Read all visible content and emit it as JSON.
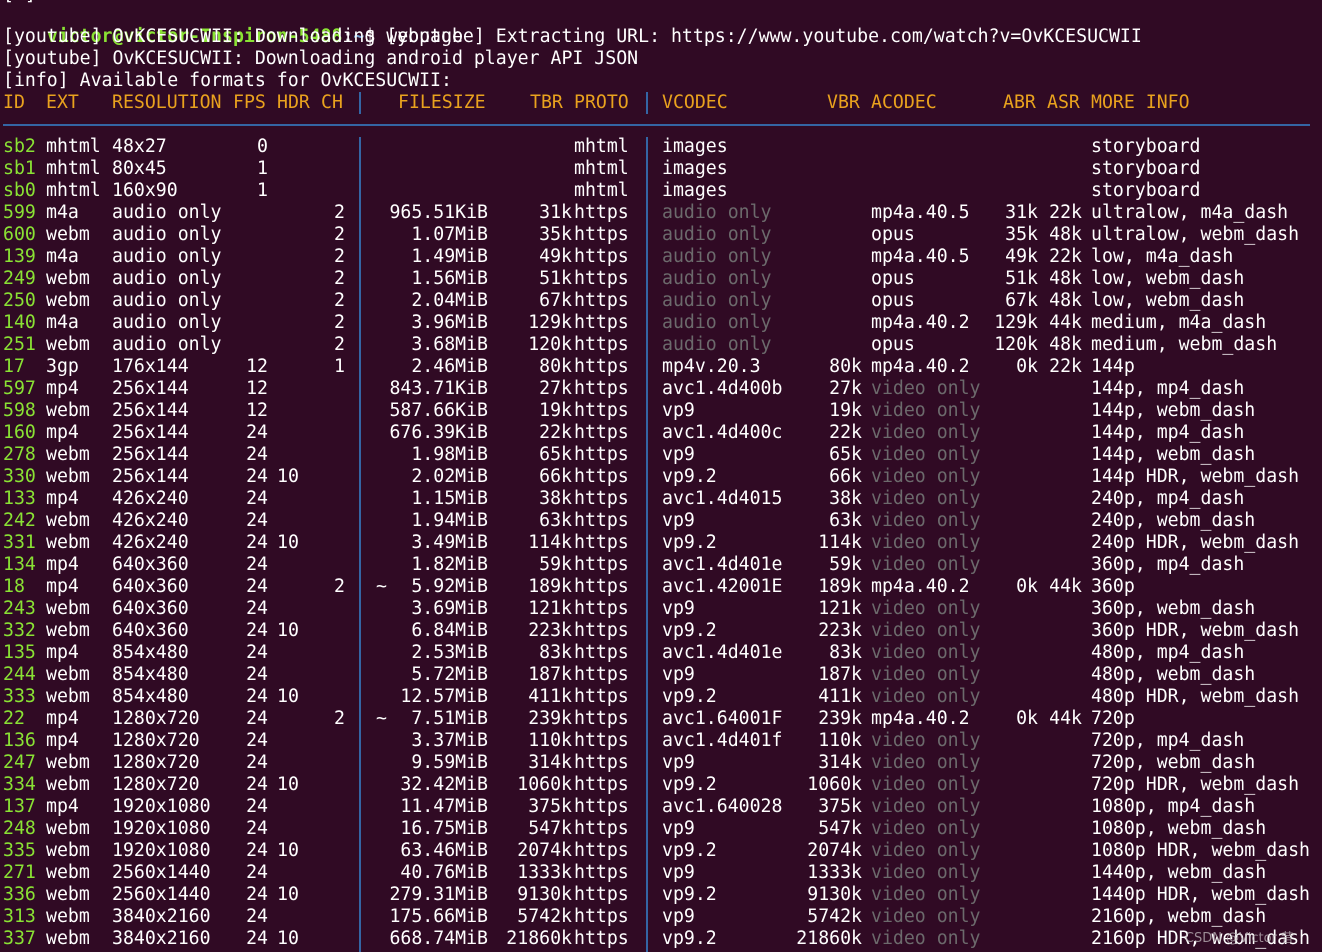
{
  "top_fragment": "[ ]",
  "prompt": {
    "user_host": "victor@victor-Inspiron-5488",
    "path": ":~",
    "symbol": "$",
    "command": " [youtube] Extracting URL: https://www.youtube.com/watch?v=OvKCESUCWII"
  },
  "log_lines": [
    "[youtube] OvKCESUCWII: Downloading webpage",
    "[youtube] OvKCESUCWII: Downloading android player API JSON",
    "[info] Available formats for OvKCESUCWII:"
  ],
  "headers": {
    "id": "ID",
    "ext": "EXT",
    "res": "RESOLUTION",
    "fps": "FPS",
    "hdr": "HDR",
    "ch": "CH",
    "filesize": "FILESIZE",
    "tbr": "TBR",
    "proto": "PROTO",
    "vcodec": "VCODEC",
    "vbr": "VBR",
    "acodec": "ACODEC",
    "abr": "ABR",
    "asr": "ASR",
    "info": "MORE INFO"
  },
  "formats": [
    {
      "id": "sb2",
      "ext": "mhtml",
      "res": "48x27",
      "fps": "0",
      "hdr": "",
      "ch": "",
      "approx": "",
      "size": "",
      "tbr": "",
      "proto": "mhtml",
      "vcodec": "images",
      "vcodec_dim": false,
      "vbr": "",
      "acodec": "",
      "acodec_dim": false,
      "abr": "",
      "asr": "",
      "info": "storyboard"
    },
    {
      "id": "sb1",
      "ext": "mhtml",
      "res": "80x45",
      "fps": "1",
      "hdr": "",
      "ch": "",
      "approx": "",
      "size": "",
      "tbr": "",
      "proto": "mhtml",
      "vcodec": "images",
      "vcodec_dim": false,
      "vbr": "",
      "acodec": "",
      "acodec_dim": false,
      "abr": "",
      "asr": "",
      "info": "storyboard"
    },
    {
      "id": "sb0",
      "ext": "mhtml",
      "res": "160x90",
      "fps": "1",
      "hdr": "",
      "ch": "",
      "approx": "",
      "size": "",
      "tbr": "",
      "proto": "mhtml",
      "vcodec": "images",
      "vcodec_dim": false,
      "vbr": "",
      "acodec": "",
      "acodec_dim": false,
      "abr": "",
      "asr": "",
      "info": "storyboard"
    },
    {
      "id": "599",
      "ext": "m4a",
      "res": "audio only",
      "fps": "",
      "hdr": "",
      "ch": "2",
      "approx": "",
      "size": "965.51KiB",
      "tbr": "31k",
      "proto": "https",
      "vcodec": "audio only",
      "vcodec_dim": true,
      "vbr": "",
      "acodec": "mp4a.40.5",
      "acodec_dim": false,
      "abr": "31k",
      "asr": "22k",
      "info": "ultralow, m4a_dash"
    },
    {
      "id": "600",
      "ext": "webm",
      "res": "audio only",
      "fps": "",
      "hdr": "",
      "ch": "2",
      "approx": "",
      "size": "1.07MiB",
      "tbr": "35k",
      "proto": "https",
      "vcodec": "audio only",
      "vcodec_dim": true,
      "vbr": "",
      "acodec": "opus",
      "acodec_dim": false,
      "abr": "35k",
      "asr": "48k",
      "info": "ultralow, webm_dash"
    },
    {
      "id": "139",
      "ext": "m4a",
      "res": "audio only",
      "fps": "",
      "hdr": "",
      "ch": "2",
      "approx": "",
      "size": "1.49MiB",
      "tbr": "49k",
      "proto": "https",
      "vcodec": "audio only",
      "vcodec_dim": true,
      "vbr": "",
      "acodec": "mp4a.40.5",
      "acodec_dim": false,
      "abr": "49k",
      "asr": "22k",
      "info": "low, m4a_dash"
    },
    {
      "id": "249",
      "ext": "webm",
      "res": "audio only",
      "fps": "",
      "hdr": "",
      "ch": "2",
      "approx": "",
      "size": "1.56MiB",
      "tbr": "51k",
      "proto": "https",
      "vcodec": "audio only",
      "vcodec_dim": true,
      "vbr": "",
      "acodec": "opus",
      "acodec_dim": false,
      "abr": "51k",
      "asr": "48k",
      "info": "low, webm_dash"
    },
    {
      "id": "250",
      "ext": "webm",
      "res": "audio only",
      "fps": "",
      "hdr": "",
      "ch": "2",
      "approx": "",
      "size": "2.04MiB",
      "tbr": "67k",
      "proto": "https",
      "vcodec": "audio only",
      "vcodec_dim": true,
      "vbr": "",
      "acodec": "opus",
      "acodec_dim": false,
      "abr": "67k",
      "asr": "48k",
      "info": "low, webm_dash"
    },
    {
      "id": "140",
      "ext": "m4a",
      "res": "audio only",
      "fps": "",
      "hdr": "",
      "ch": "2",
      "approx": "",
      "size": "3.96MiB",
      "tbr": "129k",
      "proto": "https",
      "vcodec": "audio only",
      "vcodec_dim": true,
      "vbr": "",
      "acodec": "mp4a.40.2",
      "acodec_dim": false,
      "abr": "129k",
      "asr": "44k",
      "info": "medium, m4a_dash"
    },
    {
      "id": "251",
      "ext": "webm",
      "res": "audio only",
      "fps": "",
      "hdr": "",
      "ch": "2",
      "approx": "",
      "size": "3.68MiB",
      "tbr": "120k",
      "proto": "https",
      "vcodec": "audio only",
      "vcodec_dim": true,
      "vbr": "",
      "acodec": "opus",
      "acodec_dim": false,
      "abr": "120k",
      "asr": "48k",
      "info": "medium, webm_dash"
    },
    {
      "id": "17",
      "ext": "3gp",
      "res": "176x144",
      "fps": "12",
      "hdr": "",
      "ch": "1",
      "approx": "",
      "size": "2.46MiB",
      "tbr": "80k",
      "proto": "https",
      "vcodec": "mp4v.20.3",
      "vcodec_dim": false,
      "vbr": "80k",
      "acodec": "mp4a.40.2",
      "acodec_dim": false,
      "abr": "0k",
      "asr": "22k",
      "info": "144p"
    },
    {
      "id": "597",
      "ext": "mp4",
      "res": "256x144",
      "fps": "12",
      "hdr": "",
      "ch": "",
      "approx": "",
      "size": "843.71KiB",
      "tbr": "27k",
      "proto": "https",
      "vcodec": "avc1.4d400b",
      "vcodec_dim": false,
      "vbr": "27k",
      "acodec": "video only",
      "acodec_dim": true,
      "abr": "",
      "asr": "",
      "info": "144p, mp4_dash"
    },
    {
      "id": "598",
      "ext": "webm",
      "res": "256x144",
      "fps": "12",
      "hdr": "",
      "ch": "",
      "approx": "",
      "size": "587.66KiB",
      "tbr": "19k",
      "proto": "https",
      "vcodec": "vp9",
      "vcodec_dim": false,
      "vbr": "19k",
      "acodec": "video only",
      "acodec_dim": true,
      "abr": "",
      "asr": "",
      "info": "144p, webm_dash"
    },
    {
      "id": "160",
      "ext": "mp4",
      "res": "256x144",
      "fps": "24",
      "hdr": "",
      "ch": "",
      "approx": "",
      "size": "676.39KiB",
      "tbr": "22k",
      "proto": "https",
      "vcodec": "avc1.4d400c",
      "vcodec_dim": false,
      "vbr": "22k",
      "acodec": "video only",
      "acodec_dim": true,
      "abr": "",
      "asr": "",
      "info": "144p, mp4_dash"
    },
    {
      "id": "278",
      "ext": "webm",
      "res": "256x144",
      "fps": "24",
      "hdr": "",
      "ch": "",
      "approx": "",
      "size": "1.98MiB",
      "tbr": "65k",
      "proto": "https",
      "vcodec": "vp9",
      "vcodec_dim": false,
      "vbr": "65k",
      "acodec": "video only",
      "acodec_dim": true,
      "abr": "",
      "asr": "",
      "info": "144p, webm_dash"
    },
    {
      "id": "330",
      "ext": "webm",
      "res": "256x144",
      "fps": "24",
      "hdr": "10",
      "ch": "",
      "approx": "",
      "size": "2.02MiB",
      "tbr": "66k",
      "proto": "https",
      "vcodec": "vp9.2",
      "vcodec_dim": false,
      "vbr": "66k",
      "acodec": "video only",
      "acodec_dim": true,
      "abr": "",
      "asr": "",
      "info": "144p HDR, webm_dash"
    },
    {
      "id": "133",
      "ext": "mp4",
      "res": "426x240",
      "fps": "24",
      "hdr": "",
      "ch": "",
      "approx": "",
      "size": "1.15MiB",
      "tbr": "38k",
      "proto": "https",
      "vcodec": "avc1.4d4015",
      "vcodec_dim": false,
      "vbr": "38k",
      "acodec": "video only",
      "acodec_dim": true,
      "abr": "",
      "asr": "",
      "info": "240p, mp4_dash"
    },
    {
      "id": "242",
      "ext": "webm",
      "res": "426x240",
      "fps": "24",
      "hdr": "",
      "ch": "",
      "approx": "",
      "size": "1.94MiB",
      "tbr": "63k",
      "proto": "https",
      "vcodec": "vp9",
      "vcodec_dim": false,
      "vbr": "63k",
      "acodec": "video only",
      "acodec_dim": true,
      "abr": "",
      "asr": "",
      "info": "240p, webm_dash"
    },
    {
      "id": "331",
      "ext": "webm",
      "res": "426x240",
      "fps": "24",
      "hdr": "10",
      "ch": "",
      "approx": "",
      "size": "3.49MiB",
      "tbr": "114k",
      "proto": "https",
      "vcodec": "vp9.2",
      "vcodec_dim": false,
      "vbr": "114k",
      "acodec": "video only",
      "acodec_dim": true,
      "abr": "",
      "asr": "",
      "info": "240p HDR, webm_dash"
    },
    {
      "id": "134",
      "ext": "mp4",
      "res": "640x360",
      "fps": "24",
      "hdr": "",
      "ch": "",
      "approx": "",
      "size": "1.82MiB",
      "tbr": "59k",
      "proto": "https",
      "vcodec": "avc1.4d401e",
      "vcodec_dim": false,
      "vbr": "59k",
      "acodec": "video only",
      "acodec_dim": true,
      "abr": "",
      "asr": "",
      "info": "360p, mp4_dash"
    },
    {
      "id": "18",
      "ext": "mp4",
      "res": "640x360",
      "fps": "24",
      "hdr": "",
      "ch": "2",
      "approx": "~",
      "size": "5.92MiB",
      "tbr": "189k",
      "proto": "https",
      "vcodec": "avc1.42001E",
      "vcodec_dim": false,
      "vbr": "189k",
      "acodec": "mp4a.40.2",
      "acodec_dim": false,
      "abr": "0k",
      "asr": "44k",
      "info": "360p"
    },
    {
      "id": "243",
      "ext": "webm",
      "res": "640x360",
      "fps": "24",
      "hdr": "",
      "ch": "",
      "approx": "",
      "size": "3.69MiB",
      "tbr": "121k",
      "proto": "https",
      "vcodec": "vp9",
      "vcodec_dim": false,
      "vbr": "121k",
      "acodec": "video only",
      "acodec_dim": true,
      "abr": "",
      "asr": "",
      "info": "360p, webm_dash"
    },
    {
      "id": "332",
      "ext": "webm",
      "res": "640x360",
      "fps": "24",
      "hdr": "10",
      "ch": "",
      "approx": "",
      "size": "6.84MiB",
      "tbr": "223k",
      "proto": "https",
      "vcodec": "vp9.2",
      "vcodec_dim": false,
      "vbr": "223k",
      "acodec": "video only",
      "acodec_dim": true,
      "abr": "",
      "asr": "",
      "info": "360p HDR, webm_dash"
    },
    {
      "id": "135",
      "ext": "mp4",
      "res": "854x480",
      "fps": "24",
      "hdr": "",
      "ch": "",
      "approx": "",
      "size": "2.53MiB",
      "tbr": "83k",
      "proto": "https",
      "vcodec": "avc1.4d401e",
      "vcodec_dim": false,
      "vbr": "83k",
      "acodec": "video only",
      "acodec_dim": true,
      "abr": "",
      "asr": "",
      "info": "480p, mp4_dash"
    },
    {
      "id": "244",
      "ext": "webm",
      "res": "854x480",
      "fps": "24",
      "hdr": "",
      "ch": "",
      "approx": "",
      "size": "5.72MiB",
      "tbr": "187k",
      "proto": "https",
      "vcodec": "vp9",
      "vcodec_dim": false,
      "vbr": "187k",
      "acodec": "video only",
      "acodec_dim": true,
      "abr": "",
      "asr": "",
      "info": "480p, webm_dash"
    },
    {
      "id": "333",
      "ext": "webm",
      "res": "854x480",
      "fps": "24",
      "hdr": "10",
      "ch": "",
      "approx": "",
      "size": "12.57MiB",
      "tbr": "411k",
      "proto": "https",
      "vcodec": "vp9.2",
      "vcodec_dim": false,
      "vbr": "411k",
      "acodec": "video only",
      "acodec_dim": true,
      "abr": "",
      "asr": "",
      "info": "480p HDR, webm_dash"
    },
    {
      "id": "22",
      "ext": "mp4",
      "res": "1280x720",
      "fps": "24",
      "hdr": "",
      "ch": "2",
      "approx": "~",
      "size": "7.51MiB",
      "tbr": "239k",
      "proto": "https",
      "vcodec": "avc1.64001F",
      "vcodec_dim": false,
      "vbr": "239k",
      "acodec": "mp4a.40.2",
      "acodec_dim": false,
      "abr": "0k",
      "asr": "44k",
      "info": "720p"
    },
    {
      "id": "136",
      "ext": "mp4",
      "res": "1280x720",
      "fps": "24",
      "hdr": "",
      "ch": "",
      "approx": "",
      "size": "3.37MiB",
      "tbr": "110k",
      "proto": "https",
      "vcodec": "avc1.4d401f",
      "vcodec_dim": false,
      "vbr": "110k",
      "acodec": "video only",
      "acodec_dim": true,
      "abr": "",
      "asr": "",
      "info": "720p, mp4_dash"
    },
    {
      "id": "247",
      "ext": "webm",
      "res": "1280x720",
      "fps": "24",
      "hdr": "",
      "ch": "",
      "approx": "",
      "size": "9.59MiB",
      "tbr": "314k",
      "proto": "https",
      "vcodec": "vp9",
      "vcodec_dim": false,
      "vbr": "314k",
      "acodec": "video only",
      "acodec_dim": true,
      "abr": "",
      "asr": "",
      "info": "720p, webm_dash"
    },
    {
      "id": "334",
      "ext": "webm",
      "res": "1280x720",
      "fps": "24",
      "hdr": "10",
      "ch": "",
      "approx": "",
      "size": "32.42MiB",
      "tbr": "1060k",
      "proto": "https",
      "vcodec": "vp9.2",
      "vcodec_dim": false,
      "vbr": "1060k",
      "acodec": "video only",
      "acodec_dim": true,
      "abr": "",
      "asr": "",
      "info": "720p HDR, webm_dash"
    },
    {
      "id": "137",
      "ext": "mp4",
      "res": "1920x1080",
      "fps": "24",
      "hdr": "",
      "ch": "",
      "approx": "",
      "size": "11.47MiB",
      "tbr": "375k",
      "proto": "https",
      "vcodec": "avc1.640028",
      "vcodec_dim": false,
      "vbr": "375k",
      "acodec": "video only",
      "acodec_dim": true,
      "abr": "",
      "asr": "",
      "info": "1080p, mp4_dash"
    },
    {
      "id": "248",
      "ext": "webm",
      "res": "1920x1080",
      "fps": "24",
      "hdr": "",
      "ch": "",
      "approx": "",
      "size": "16.75MiB",
      "tbr": "547k",
      "proto": "https",
      "vcodec": "vp9",
      "vcodec_dim": false,
      "vbr": "547k",
      "acodec": "video only",
      "acodec_dim": true,
      "abr": "",
      "asr": "",
      "info": "1080p, webm_dash"
    },
    {
      "id": "335",
      "ext": "webm",
      "res": "1920x1080",
      "fps": "24",
      "hdr": "10",
      "ch": "",
      "approx": "",
      "size": "63.46MiB",
      "tbr": "2074k",
      "proto": "https",
      "vcodec": "vp9.2",
      "vcodec_dim": false,
      "vbr": "2074k",
      "acodec": "video only",
      "acodec_dim": true,
      "abr": "",
      "asr": "",
      "info": "1080p HDR, webm_dash"
    },
    {
      "id": "271",
      "ext": "webm",
      "res": "2560x1440",
      "fps": "24",
      "hdr": "",
      "ch": "",
      "approx": "",
      "size": "40.76MiB",
      "tbr": "1333k",
      "proto": "https",
      "vcodec": "vp9",
      "vcodec_dim": false,
      "vbr": "1333k",
      "acodec": "video only",
      "acodec_dim": true,
      "abr": "",
      "asr": "",
      "info": "1440p, webm_dash"
    },
    {
      "id": "336",
      "ext": "webm",
      "res": "2560x1440",
      "fps": "24",
      "hdr": "10",
      "ch": "",
      "approx": "",
      "size": "279.31MiB",
      "tbr": "9130k",
      "proto": "https",
      "vcodec": "vp9.2",
      "vcodec_dim": false,
      "vbr": "9130k",
      "acodec": "video only",
      "acodec_dim": true,
      "abr": "",
      "asr": "",
      "info": "1440p HDR, webm_dash"
    },
    {
      "id": "313",
      "ext": "webm",
      "res": "3840x2160",
      "fps": "24",
      "hdr": "",
      "ch": "",
      "approx": "",
      "size": "175.66MiB",
      "tbr": "5742k",
      "proto": "https",
      "vcodec": "vp9",
      "vcodec_dim": false,
      "vbr": "5742k",
      "acodec": "video only",
      "acodec_dim": true,
      "abr": "",
      "asr": "",
      "info": "2160p, webm_dash"
    },
    {
      "id": "337",
      "ext": "webm",
      "res": "3840x2160",
      "fps": "24",
      "hdr": "10",
      "ch": "",
      "approx": "",
      "size": "668.74MiB",
      "tbr": "21860k",
      "proto": "https",
      "vcodec": "vp9.2",
      "vcodec_dim": false,
      "vbr": "21860k",
      "acodec": "video only",
      "acodec_dim": true,
      "abr": "",
      "asr": "",
      "info": "2160p HDR, webm_dash"
    }
  ],
  "watermark": "CSDN @Victor 昔",
  "colors": {
    "background": "#300a24",
    "prompt_user": "#8ae234",
    "prompt_path": "#729fcf",
    "header": "#e9a21e",
    "format_id": "#8ae234",
    "separator": "#3465a4",
    "dim_text": "#6c6a6c"
  }
}
